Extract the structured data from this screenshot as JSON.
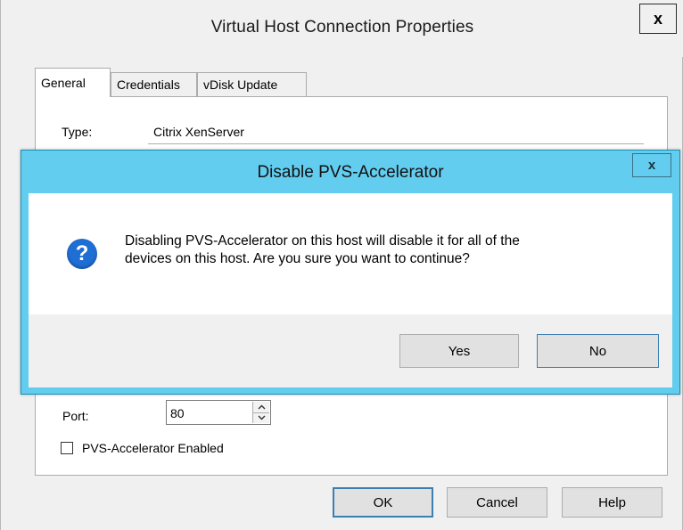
{
  "parent": {
    "title": "Virtual Host Connection Properties",
    "close_label": "x",
    "tabs": [
      {
        "label": "General",
        "active": true
      },
      {
        "label": "Credentials",
        "active": false
      },
      {
        "label": "vDisk Update",
        "active": false
      }
    ],
    "general": {
      "type_label": "Type:",
      "type_value": "Citrix XenServer",
      "port_label": "Port:",
      "port_value": "80",
      "pvs_checkbox_label": "PVS-Accelerator Enabled",
      "pvs_checked": false
    },
    "buttons": {
      "ok": "OK",
      "cancel": "Cancel",
      "help": "Help"
    }
  },
  "dialog": {
    "title": "Disable PVS-Accelerator",
    "close_label": "x",
    "icon": "question-icon",
    "icon_glyph": "?",
    "message_lines": [
      "Disabling PVS-Accelerator on this host will disable it for all of the",
      "devices on this host. Are you sure you want to continue?"
    ],
    "buttons": {
      "yes": "Yes",
      "no": "No"
    },
    "accent_color": "#62cdef"
  }
}
